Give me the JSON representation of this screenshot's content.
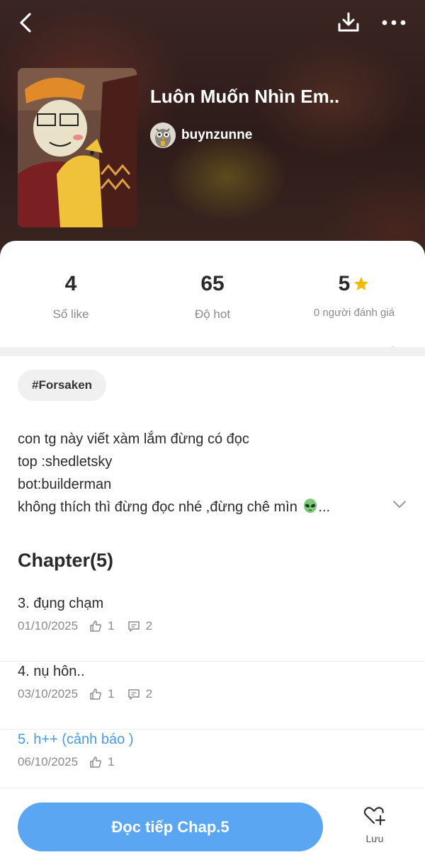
{
  "header": {
    "title": "Luôn Muốn Nhìn Em..",
    "author": "buynzunne"
  },
  "stats": {
    "likes": {
      "value": "4",
      "label": "Số like"
    },
    "hot": {
      "value": "65",
      "label": "Độ hot"
    },
    "rating": {
      "value": "5",
      "label": "0 người đánh giá"
    }
  },
  "tag": "#Forsaken",
  "description": {
    "lines": [
      "con tg này viết xàm lắm đừng có đọc",
      "top :shedletsky",
      "bot:builderman",
      "không thích thì đừng đọc nhé ,đừng chê mìn"
    ],
    "ellipsis": "..."
  },
  "chapters": {
    "heading": "Chapter(5)",
    "items": [
      {
        "title": "3. đụng chạm",
        "date": "01/10/2025",
        "likes": "1",
        "comments": "2"
      },
      {
        "title": "4. nụ hôn..",
        "date": "03/10/2025",
        "likes": "1",
        "comments": "2"
      },
      {
        "title": "5. h++ (cảnh báo )",
        "date": "06/10/2025",
        "likes": "1"
      }
    ]
  },
  "bottom": {
    "read_label": "Đọc tiếp Chap.5",
    "save_label": "Lưu"
  },
  "colors": {
    "accent": "#5aa6f2",
    "current_chapter": "#4a9ae8",
    "star": "#f5b800"
  }
}
